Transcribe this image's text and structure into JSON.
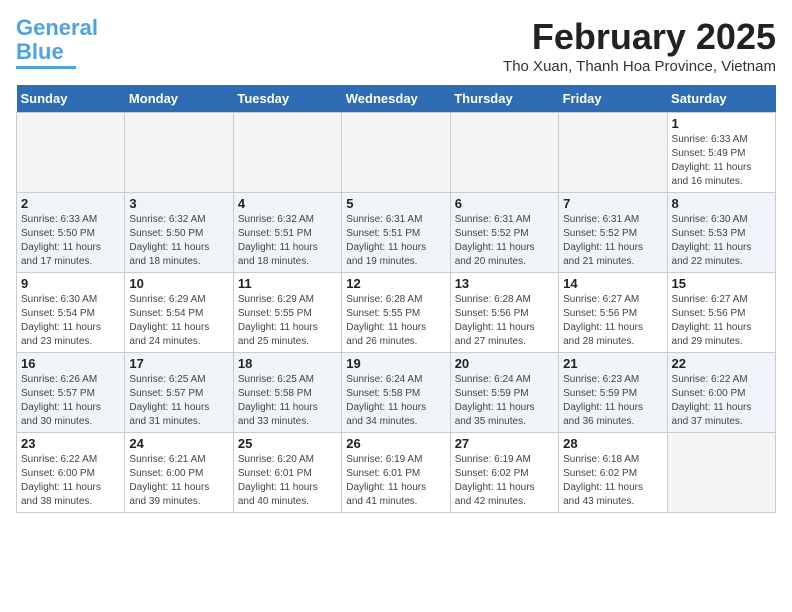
{
  "header": {
    "logo_line1": "General",
    "logo_line2": "Blue",
    "month_year": "February 2025",
    "location": "Tho Xuan, Thanh Hoa Province, Vietnam"
  },
  "weekdays": [
    "Sunday",
    "Monday",
    "Tuesday",
    "Wednesday",
    "Thursday",
    "Friday",
    "Saturday"
  ],
  "weeks": [
    [
      {
        "day": "",
        "info": ""
      },
      {
        "day": "",
        "info": ""
      },
      {
        "day": "",
        "info": ""
      },
      {
        "day": "",
        "info": ""
      },
      {
        "day": "",
        "info": ""
      },
      {
        "day": "",
        "info": ""
      },
      {
        "day": "1",
        "info": "Sunrise: 6:33 AM\nSunset: 5:49 PM\nDaylight: 11 hours\nand 16 minutes."
      }
    ],
    [
      {
        "day": "2",
        "info": "Sunrise: 6:33 AM\nSunset: 5:50 PM\nDaylight: 11 hours\nand 17 minutes."
      },
      {
        "day": "3",
        "info": "Sunrise: 6:32 AM\nSunset: 5:50 PM\nDaylight: 11 hours\nand 18 minutes."
      },
      {
        "day": "4",
        "info": "Sunrise: 6:32 AM\nSunset: 5:51 PM\nDaylight: 11 hours\nand 18 minutes."
      },
      {
        "day": "5",
        "info": "Sunrise: 6:31 AM\nSunset: 5:51 PM\nDaylight: 11 hours\nand 19 minutes."
      },
      {
        "day": "6",
        "info": "Sunrise: 6:31 AM\nSunset: 5:52 PM\nDaylight: 11 hours\nand 20 minutes."
      },
      {
        "day": "7",
        "info": "Sunrise: 6:31 AM\nSunset: 5:52 PM\nDaylight: 11 hours\nand 21 minutes."
      },
      {
        "day": "8",
        "info": "Sunrise: 6:30 AM\nSunset: 5:53 PM\nDaylight: 11 hours\nand 22 minutes."
      }
    ],
    [
      {
        "day": "9",
        "info": "Sunrise: 6:30 AM\nSunset: 5:54 PM\nDaylight: 11 hours\nand 23 minutes."
      },
      {
        "day": "10",
        "info": "Sunrise: 6:29 AM\nSunset: 5:54 PM\nDaylight: 11 hours\nand 24 minutes."
      },
      {
        "day": "11",
        "info": "Sunrise: 6:29 AM\nSunset: 5:55 PM\nDaylight: 11 hours\nand 25 minutes."
      },
      {
        "day": "12",
        "info": "Sunrise: 6:28 AM\nSunset: 5:55 PM\nDaylight: 11 hours\nand 26 minutes."
      },
      {
        "day": "13",
        "info": "Sunrise: 6:28 AM\nSunset: 5:56 PM\nDaylight: 11 hours\nand 27 minutes."
      },
      {
        "day": "14",
        "info": "Sunrise: 6:27 AM\nSunset: 5:56 PM\nDaylight: 11 hours\nand 28 minutes."
      },
      {
        "day": "15",
        "info": "Sunrise: 6:27 AM\nSunset: 5:56 PM\nDaylight: 11 hours\nand 29 minutes."
      }
    ],
    [
      {
        "day": "16",
        "info": "Sunrise: 6:26 AM\nSunset: 5:57 PM\nDaylight: 11 hours\nand 30 minutes."
      },
      {
        "day": "17",
        "info": "Sunrise: 6:25 AM\nSunset: 5:57 PM\nDaylight: 11 hours\nand 31 minutes."
      },
      {
        "day": "18",
        "info": "Sunrise: 6:25 AM\nSunset: 5:58 PM\nDaylight: 11 hours\nand 33 minutes."
      },
      {
        "day": "19",
        "info": "Sunrise: 6:24 AM\nSunset: 5:58 PM\nDaylight: 11 hours\nand 34 minutes."
      },
      {
        "day": "20",
        "info": "Sunrise: 6:24 AM\nSunset: 5:59 PM\nDaylight: 11 hours\nand 35 minutes."
      },
      {
        "day": "21",
        "info": "Sunrise: 6:23 AM\nSunset: 5:59 PM\nDaylight: 11 hours\nand 36 minutes."
      },
      {
        "day": "22",
        "info": "Sunrise: 6:22 AM\nSunset: 6:00 PM\nDaylight: 11 hours\nand 37 minutes."
      }
    ],
    [
      {
        "day": "23",
        "info": "Sunrise: 6:22 AM\nSunset: 6:00 PM\nDaylight: 11 hours\nand 38 minutes."
      },
      {
        "day": "24",
        "info": "Sunrise: 6:21 AM\nSunset: 6:00 PM\nDaylight: 11 hours\nand 39 minutes."
      },
      {
        "day": "25",
        "info": "Sunrise: 6:20 AM\nSunset: 6:01 PM\nDaylight: 11 hours\nand 40 minutes."
      },
      {
        "day": "26",
        "info": "Sunrise: 6:19 AM\nSunset: 6:01 PM\nDaylight: 11 hours\nand 41 minutes."
      },
      {
        "day": "27",
        "info": "Sunrise: 6:19 AM\nSunset: 6:02 PM\nDaylight: 11 hours\nand 42 minutes."
      },
      {
        "day": "28",
        "info": "Sunrise: 6:18 AM\nSunset: 6:02 PM\nDaylight: 11 hours\nand 43 minutes."
      },
      {
        "day": "",
        "info": ""
      }
    ]
  ]
}
